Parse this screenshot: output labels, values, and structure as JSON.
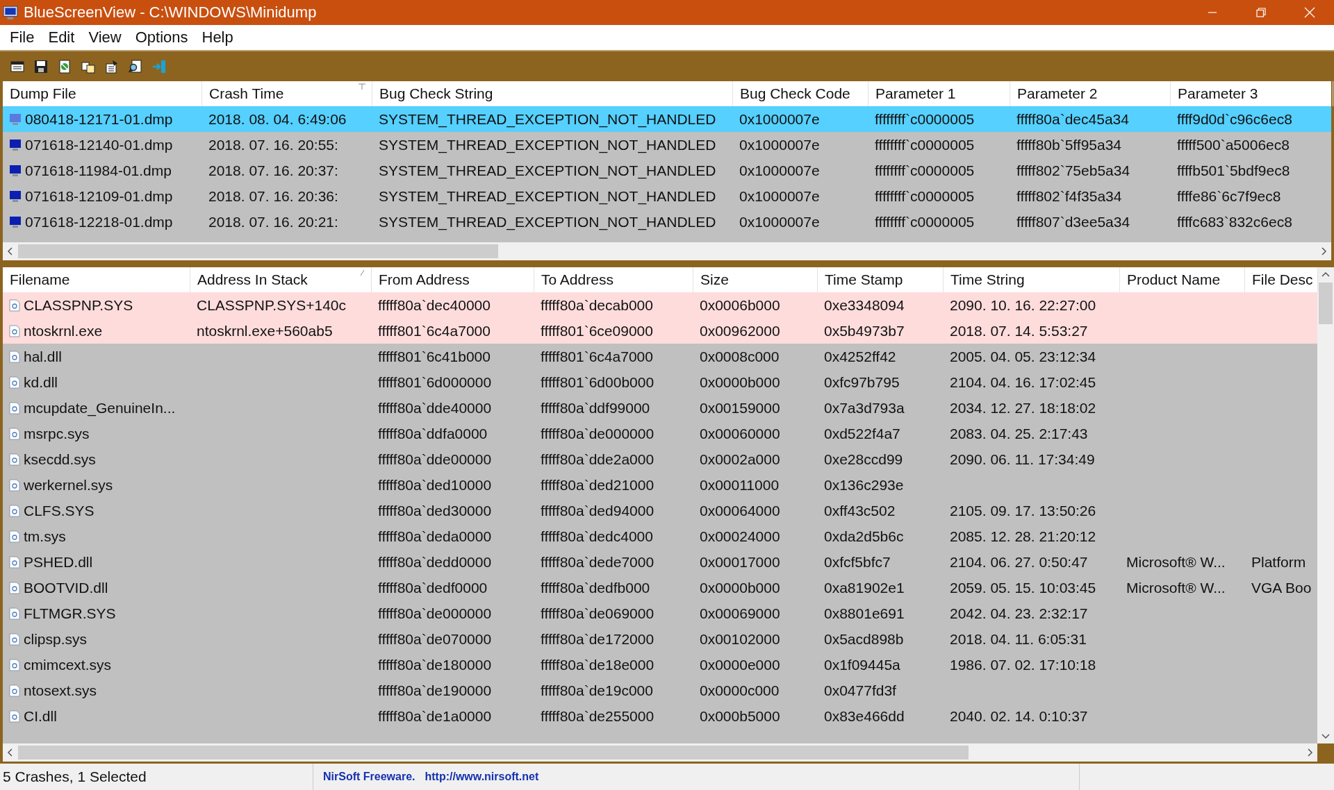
{
  "window": {
    "title": "BlueScreenView  -  C:\\WINDOWS\\Minidump"
  },
  "menu": [
    "File",
    "Edit",
    "View",
    "Options",
    "Help"
  ],
  "crash_list": {
    "columns": [
      {
        "label": "Dump File",
        "sorted": false
      },
      {
        "label": "Crash Time",
        "sorted": true
      },
      {
        "label": "Bug Check String",
        "sorted": false
      },
      {
        "label": "Bug Check Code",
        "sorted": false
      },
      {
        "label": "Parameter 1",
        "sorted": false
      },
      {
        "label": "Parameter 2",
        "sorted": false
      },
      {
        "label": "Parameter 3",
        "sorted": false
      }
    ],
    "rows": [
      {
        "selected": true,
        "dump_file": "080418-12171-01.dmp",
        "crash_time": "2018. 08. 04. 6:49:06",
        "bug_check_string": "SYSTEM_THREAD_EXCEPTION_NOT_HANDLED",
        "bug_check_code": "0x1000007e",
        "parameter_1": "ffffffff`c0000005",
        "parameter_2": "fffff80a`dec45a34",
        "parameter_3": "ffff9d0d`c96c6ec8"
      },
      {
        "selected": false,
        "dump_file": "071618-12140-01.dmp",
        "crash_time": "2018. 07. 16. 20:55:",
        "bug_check_string": "SYSTEM_THREAD_EXCEPTION_NOT_HANDLED",
        "bug_check_code": "0x1000007e",
        "parameter_1": "ffffffff`c0000005",
        "parameter_2": "fffff80b`5ff95a34",
        "parameter_3": "fffff500`a5006ec8"
      },
      {
        "selected": false,
        "dump_file": "071618-11984-01.dmp",
        "crash_time": "2018. 07. 16. 20:37:",
        "bug_check_string": "SYSTEM_THREAD_EXCEPTION_NOT_HANDLED",
        "bug_check_code": "0x1000007e",
        "parameter_1": "ffffffff`c0000005",
        "parameter_2": "fffff802`75eb5a34",
        "parameter_3": "ffffb501`5bdf9ec8"
      },
      {
        "selected": false,
        "dump_file": "071618-12109-01.dmp",
        "crash_time": "2018. 07. 16. 20:36:",
        "bug_check_string": "SYSTEM_THREAD_EXCEPTION_NOT_HANDLED",
        "bug_check_code": "0x1000007e",
        "parameter_1": "ffffffff`c0000005",
        "parameter_2": "fffff802`f4f35a34",
        "parameter_3": "ffffe86`6c7f9ec8"
      },
      {
        "selected": false,
        "dump_file": "071618-12218-01.dmp",
        "crash_time": "2018. 07. 16. 20:21:",
        "bug_check_string": "SYSTEM_THREAD_EXCEPTION_NOT_HANDLED",
        "bug_check_code": "0x1000007e",
        "parameter_1": "ffffffff`c0000005",
        "parameter_2": "fffff807`d3ee5a34",
        "parameter_3": "ffffc683`832c6ec8"
      }
    ]
  },
  "driver_list": {
    "columns": [
      {
        "label": "Filename",
        "sorted": false
      },
      {
        "label": "Address In Stack",
        "sorted": true
      },
      {
        "label": "From Address",
        "sorted": false
      },
      {
        "label": "To Address",
        "sorted": false
      },
      {
        "label": "Size",
        "sorted": false
      },
      {
        "label": "Time Stamp",
        "sorted": false
      },
      {
        "label": "Time String",
        "sorted": false
      },
      {
        "label": "Product Name",
        "sorted": false
      },
      {
        "label": "File Desc",
        "sorted": false
      }
    ],
    "rows": [
      {
        "highlighted": true,
        "filename": "CLASSPNP.SYS",
        "address_in_stack": "CLASSPNP.SYS+140c",
        "from_address": "fffff80a`dec40000",
        "to_address": "fffff80a`decab000",
        "size": "0x0006b000",
        "time_stamp": "0xe3348094",
        "time_string": "2090. 10. 16. 22:27:00"
      },
      {
        "highlighted": true,
        "filename": "ntoskrnl.exe",
        "address_in_stack": "ntoskrnl.exe+560ab5",
        "from_address": "fffff801`6c4a7000",
        "to_address": "fffff801`6ce09000",
        "size": "0x00962000",
        "time_stamp": "0x5b4973b7",
        "time_string": "2018. 07. 14. 5:53:27"
      },
      {
        "highlighted": false,
        "filename": "hal.dll",
        "from_address": "fffff801`6c41b000",
        "to_address": "fffff801`6c4a7000",
        "size": "0x0008c000",
        "time_stamp": "0x4252ff42",
        "time_string": "2005. 04. 05. 23:12:34"
      },
      {
        "highlighted": false,
        "filename": "kd.dll",
        "from_address": "fffff801`6d000000",
        "to_address": "fffff801`6d00b000",
        "size": "0x0000b000",
        "time_stamp": "0xfc97b795",
        "time_string": "2104. 04. 16. 17:02:45"
      },
      {
        "highlighted": false,
        "filename": "mcupdate_GenuineIn...",
        "from_address": "fffff80a`dde40000",
        "to_address": "fffff80a`ddf99000",
        "size": "0x00159000",
        "time_stamp": "0x7a3d793a",
        "time_string": "2034. 12. 27. 18:18:02"
      },
      {
        "highlighted": false,
        "filename": "msrpc.sys",
        "from_address": "fffff80a`ddfa0000",
        "to_address": "fffff80a`de000000",
        "size": "0x00060000",
        "time_stamp": "0xd522f4a7",
        "time_string": "2083. 04. 25. 2:17:43"
      },
      {
        "highlighted": false,
        "filename": "ksecdd.sys",
        "from_address": "fffff80a`dde00000",
        "to_address": "fffff80a`dde2a000",
        "size": "0x0002a000",
        "time_stamp": "0xe28ccd99",
        "time_string": "2090. 06. 11. 17:34:49"
      },
      {
        "highlighted": false,
        "filename": "werkernel.sys",
        "from_address": "fffff80a`ded10000",
        "to_address": "fffff80a`ded21000",
        "size": "0x00011000",
        "time_stamp": "0x136c293e"
      },
      {
        "highlighted": false,
        "filename": "CLFS.SYS",
        "from_address": "fffff80a`ded30000",
        "to_address": "fffff80a`ded94000",
        "size": "0x00064000",
        "time_stamp": "0xff43c502",
        "time_string": "2105. 09. 17. 13:50:26"
      },
      {
        "highlighted": false,
        "filename": "tm.sys",
        "from_address": "fffff80a`deda0000",
        "to_address": "fffff80a`dedc4000",
        "size": "0x00024000",
        "time_stamp": "0xda2d5b6c",
        "time_string": "2085. 12. 28. 21:20:12"
      },
      {
        "highlighted": false,
        "filename": "PSHED.dll",
        "from_address": "fffff80a`dedd0000",
        "to_address": "fffff80a`dede7000",
        "size": "0x00017000",
        "time_stamp": "0xfcf5bfc7",
        "time_string": "2104. 06. 27. 0:50:47",
        "product_name": "Microsoft® W...",
        "file_description": "Platform"
      },
      {
        "highlighted": false,
        "filename": "BOOTVID.dll",
        "from_address": "fffff80a`dedf0000",
        "to_address": "fffff80a`dedfb000",
        "size": "0x0000b000",
        "time_stamp": "0xa81902e1",
        "time_string": "2059. 05. 15. 10:03:45",
        "product_name": "Microsoft® W...",
        "file_description": "VGA Boo"
      },
      {
        "highlighted": false,
        "filename": "FLTMGR.SYS",
        "from_address": "fffff80a`de000000",
        "to_address": "fffff80a`de069000",
        "size": "0x00069000",
        "time_stamp": "0x8801e691",
        "time_string": "2042. 04. 23. 2:32:17"
      },
      {
        "highlighted": false,
        "filename": "clipsp.sys",
        "from_address": "fffff80a`de070000",
        "to_address": "fffff80a`de172000",
        "size": "0x00102000",
        "time_stamp": "0x5acd898b",
        "time_string": "2018. 04. 11. 6:05:31"
      },
      {
        "highlighted": false,
        "filename": "cmimcext.sys",
        "from_address": "fffff80a`de180000",
        "to_address": "fffff80a`de18e000",
        "size": "0x0000e000",
        "time_stamp": "0x1f09445a",
        "time_string": "1986. 07. 02. 17:10:18"
      },
      {
        "highlighted": false,
        "filename": "ntosext.sys",
        "from_address": "fffff80a`de190000",
        "to_address": "fffff80a`de19c000",
        "size": "0x0000c000",
        "time_stamp": "0x0477fd3f"
      },
      {
        "highlighted": false,
        "filename": "CI.dll",
        "from_address": "fffff80a`de1a0000",
        "to_address": "fffff80a`de255000",
        "size": "0x000b5000",
        "time_stamp": "0x83e466dd",
        "time_string": "2040. 02. 14. 0:10:37"
      }
    ]
  },
  "status_bar": {
    "summary": "5 Crashes, 1 Selected",
    "credit": "NirSoft Freeware.",
    "link": "http://www.nirsoft.net"
  }
}
